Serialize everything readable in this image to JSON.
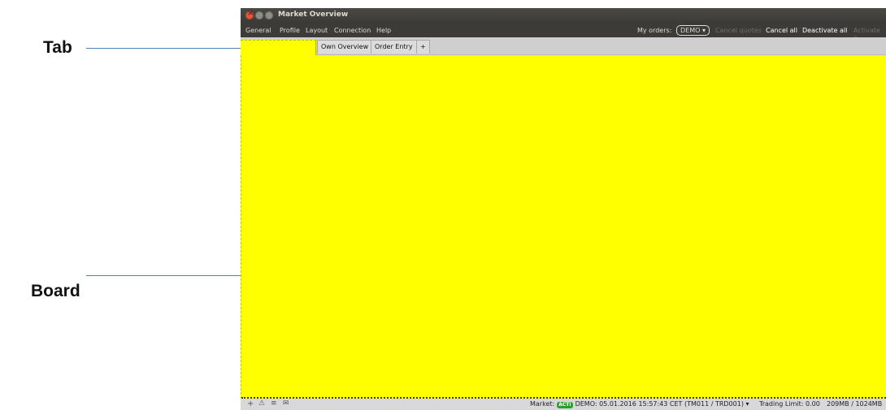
{
  "callouts": {
    "tab": "Tab",
    "board": "Board"
  },
  "window": {
    "title": "Market Overview"
  },
  "menu": {
    "items": [
      "General",
      "Profile",
      "Layout",
      "Connection",
      "Help"
    ],
    "orders_label": "My orders:",
    "orders_select": "DEMO",
    "cancel_quotes": "Cancel quotes",
    "cancel_all": "Cancel all",
    "deactivate_all": "Deactivate all",
    "activate_all": "Activate a"
  },
  "tabs": {
    "own_overview": "Own Overview",
    "order_entry": "Order Entry",
    "add": "+"
  },
  "colors": {
    "board_highlight": "#ffff00",
    "status_acti": "#2e9e2e"
  },
  "status": {
    "market_label": "Market:",
    "market_badge": "ACTI",
    "info": "DEMO: 05.01.2016 15:57:43 CET (TM011 / TRD001) ▾",
    "trading_limit": "Trading Limit: 0.00",
    "memory": "209MB / 1024MB"
  },
  "icons": {
    "add": "plus-icon",
    "warning": "warning-icon",
    "list": "list-icon",
    "mail": "mail-icon"
  }
}
